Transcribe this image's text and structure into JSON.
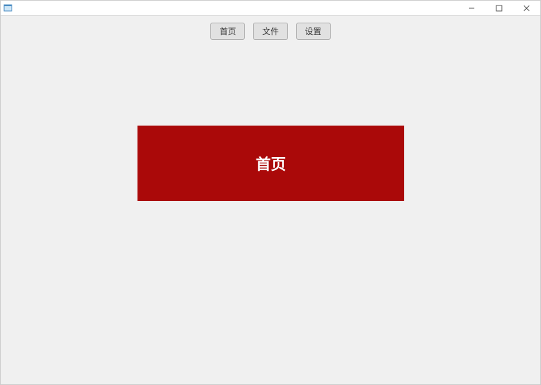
{
  "toolbar": {
    "home_label": "首页",
    "file_label": "文件",
    "settings_label": "设置"
  },
  "panel": {
    "title": "首页"
  }
}
